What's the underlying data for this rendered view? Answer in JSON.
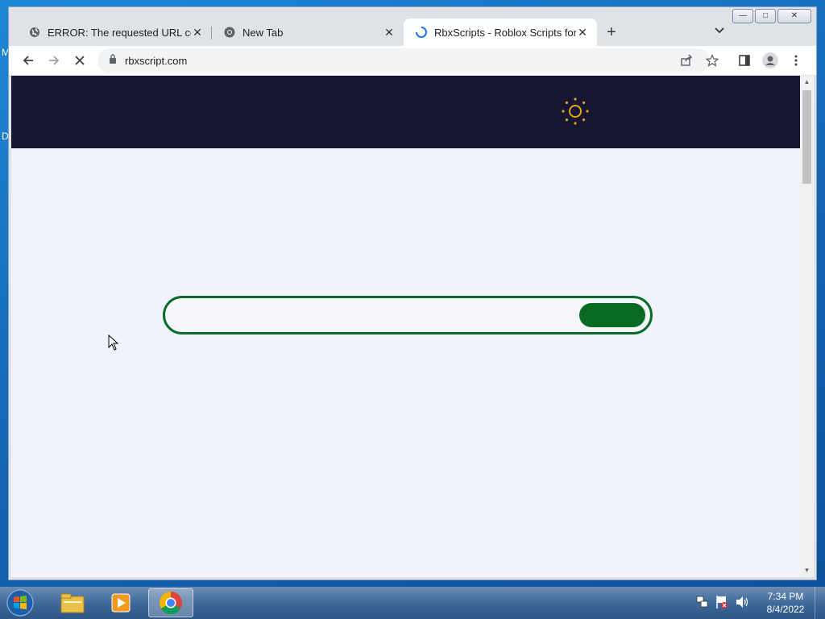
{
  "desktop": {
    "edge_labels": [
      "M",
      "D"
    ]
  },
  "browser": {
    "tabs": [
      {
        "title": "ERROR: The requested URL could",
        "icon": "globe-icon",
        "active": false
      },
      {
        "title": "New Tab",
        "icon": "chrome-icon",
        "active": false
      },
      {
        "title": "RbxScripts - Roblox Scripts for ev",
        "icon": "loading-spinner-icon",
        "active": true
      }
    ],
    "new_tab_label": "+",
    "address": {
      "url": "rbxscript.com"
    },
    "window_buttons": {
      "minimize": "—",
      "maximize": "□",
      "close": "✕"
    }
  },
  "page": {
    "header_bg": "#161633",
    "sun_color": "#e8a317",
    "loader": {
      "border_color": "#0a6a2a",
      "fill_color": "#0a6a22"
    }
  },
  "taskbar": {
    "items": [
      "windows-start-icon",
      "file-explorer-icon",
      "media-player-icon",
      "chrome-icon"
    ],
    "tray_icons": [
      "network-icon",
      "action-center-flag-icon",
      "volume-icon"
    ],
    "time": "7:34 PM",
    "date": "8/4/2022"
  }
}
